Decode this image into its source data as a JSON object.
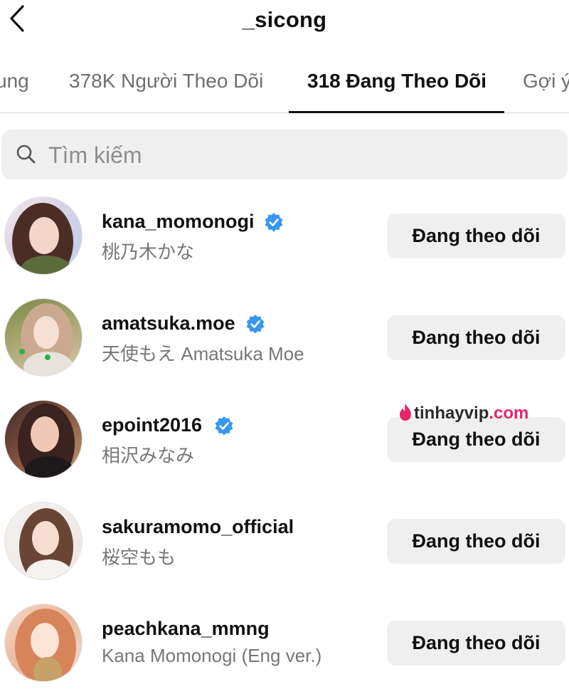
{
  "header": {
    "title": "_sicong",
    "back_icon": "chevron-left-icon"
  },
  "tabs": [
    {
      "label": "ung",
      "active": false
    },
    {
      "label": "378K Người Theo Dõi",
      "active": false
    },
    {
      "label": "318 Đang Theo Dõi",
      "active": true
    },
    {
      "label": "Gợi ý",
      "active": false
    }
  ],
  "search": {
    "placeholder": "Tìm kiếm",
    "value": "",
    "icon": "search-icon"
  },
  "accounts": [
    {
      "username": "kana_momonogi",
      "full_name": "桃乃木かな",
      "verified": true,
      "button": "Đang theo dõi"
    },
    {
      "username": "amatsuka.moe",
      "full_name": "天使もえ Amatsuka Moe",
      "verified": true,
      "button": "Đang theo dõi"
    },
    {
      "username": "epoint2016",
      "full_name": "相沢みなみ",
      "verified": true,
      "button": "Đang theo dõi"
    },
    {
      "username": "sakuramomo_official",
      "full_name": "桜空もも",
      "verified": false,
      "button": "Đang theo dõi"
    },
    {
      "username": "peachkana_mmng",
      "full_name": "Kana Momonogi (Eng ver.)",
      "verified": false,
      "button": "Đang theo dõi"
    }
  ],
  "watermark": {
    "text_main": "tinhayvip",
    "text_suffix": ".com",
    "icon": "flame-logo-icon"
  },
  "colors": {
    "verified_blue": "#3897f0",
    "button_bg": "#efefef",
    "watermark_pink": "#e8246b"
  }
}
